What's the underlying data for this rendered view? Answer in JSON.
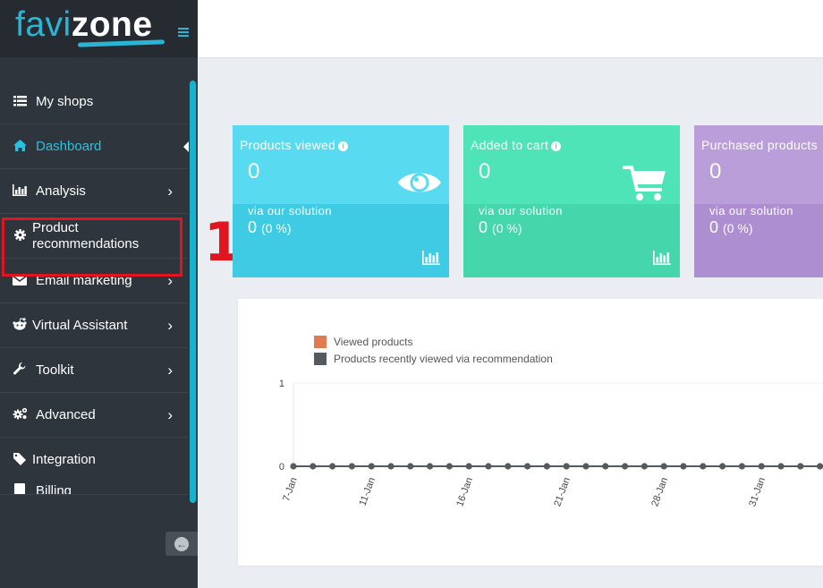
{
  "brand": {
    "part1": "favi",
    "part2": "zone"
  },
  "sidebar": {
    "items": [
      {
        "label": "My shops",
        "icon": "list-icon",
        "chevron": false
      },
      {
        "label": "Dashboard",
        "icon": "home-icon",
        "chevron": false,
        "active": true
      },
      {
        "label": "Analysis",
        "icon": "bar-chart-icon",
        "chevron": true
      },
      {
        "label": "Product recommendations",
        "icon": "gear-icon",
        "chevron": false
      },
      {
        "label": "Email marketing",
        "icon": "envelope-icon",
        "chevron": true
      },
      {
        "label": "Virtual Assistant",
        "icon": "reddit-icon",
        "chevron": true
      },
      {
        "label": "Toolkit",
        "icon": "wrench-icon",
        "chevron": true
      },
      {
        "label": "Advanced",
        "icon": "gears-icon",
        "chevron": true
      },
      {
        "label": "Integration",
        "icon": "tag-icon",
        "chevron": false
      },
      {
        "label": "Billing",
        "icon": "billing-icon",
        "chevron": false
      }
    ]
  },
  "annotation": {
    "number": "1"
  },
  "cards": [
    {
      "title": "Products viewed",
      "value": "0",
      "via": "via our solution",
      "sub_value": "0",
      "sub_pct": "(0 %)",
      "color": "#58dbf1"
    },
    {
      "title": "Added to cart",
      "value": "0",
      "via": "via our solution",
      "sub_value": "0",
      "sub_pct": "(0 %)",
      "color": "#4fe3b8"
    },
    {
      "title": "Purchased products",
      "value": "0",
      "via": "via our solution",
      "sub_value": "0",
      "sub_pct": "(0 %)",
      "color": "#b99ed9"
    }
  ],
  "chart_data": {
    "type": "line",
    "x": [
      "7-Jan",
      "8-Jan",
      "9-Jan",
      "10-Jan",
      "11-Jan",
      "12-Jan",
      "13-Jan",
      "14-Jan",
      "15-Jan",
      "16-Jan",
      "17-Jan",
      "18-Jan",
      "19-Jan",
      "20-Jan",
      "21-Jan",
      "22-Jan",
      "23-Jan",
      "24-Jan",
      "25-Jan",
      "26-Jan",
      "27-Jan",
      "28-Jan",
      "29-Jan",
      "30-Jan",
      "31-Jan",
      "1-Feb",
      "2-Feb",
      "3-Feb"
    ],
    "tick_labels": [
      "7-Jan",
      "11-Jan",
      "16-Jan",
      "21-Jan",
      "28-Jan",
      "31-Jan"
    ],
    "tick_index": [
      0,
      4,
      9,
      14,
      19,
      24
    ],
    "series": [
      {
        "name": "Viewed products",
        "color": "#e07a50",
        "values": [
          0,
          0,
          0,
          0,
          0,
          0,
          0,
          0,
          0,
          0,
          0,
          0,
          0,
          0,
          0,
          0,
          0,
          0,
          0,
          0,
          0,
          0,
          0,
          0,
          0,
          0,
          0,
          0
        ]
      },
      {
        "name": "Products recently viewed via recommendation",
        "color": "#555a60",
        "values": [
          0,
          0,
          0,
          0,
          0,
          0,
          0,
          0,
          0,
          0,
          0,
          0,
          0,
          0,
          0,
          0,
          0,
          0,
          0,
          0,
          0,
          0,
          0,
          0,
          0,
          0,
          0,
          0
        ]
      }
    ],
    "y_ticks": [
      "1",
      "0"
    ],
    "ylim": [
      0,
      1
    ],
    "legend_position": "top-left"
  }
}
